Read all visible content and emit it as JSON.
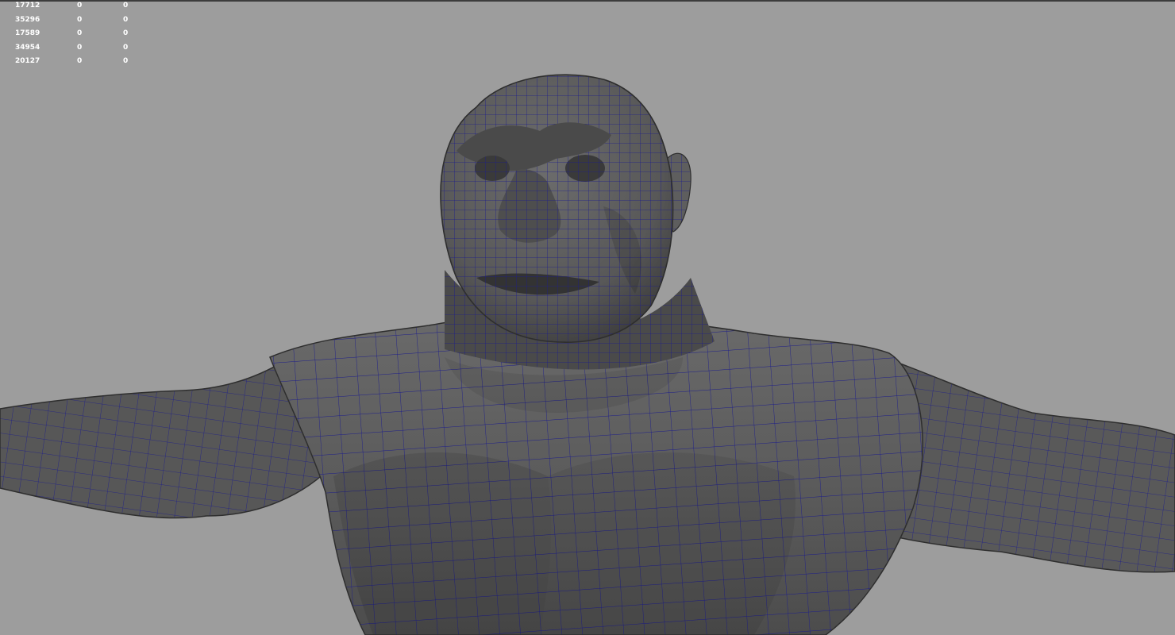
{
  "viewport": {
    "background_color": "#9d9d9d",
    "wireframe_color": "#1a1a8c",
    "mesh_color": "#595959",
    "subject": "character-model-torso-head"
  },
  "hud": {
    "rows": [
      {
        "value": "17712",
        "col2": "0",
        "col3": "0"
      },
      {
        "value": "35296",
        "col2": "0",
        "col3": "0"
      },
      {
        "value": "17589",
        "col2": "0",
        "col3": "0"
      },
      {
        "value": "34954",
        "col2": "0",
        "col3": "0"
      },
      {
        "value": "20127",
        "col2": "0",
        "col3": "0"
      }
    ]
  }
}
